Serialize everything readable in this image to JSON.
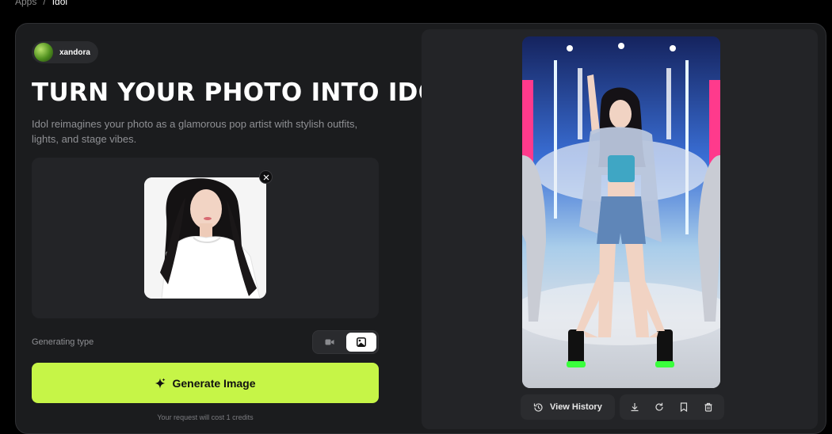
{
  "breadcrumb": {
    "root": "Apps",
    "separator": "/",
    "current": "Idol"
  },
  "author": {
    "name": "xandora"
  },
  "hero": {
    "title": "TURN YOUR PHOTO INTO IDOL",
    "description": "Idol reimagines your photo as a glamorous pop artist with stylish outfits, lights, and stage vibes."
  },
  "upload": {
    "icons": {
      "remove": "close-icon"
    }
  },
  "generating": {
    "label": "Generating type",
    "options": [
      {
        "icon": "video-icon",
        "active": false
      },
      {
        "icon": "image-icon",
        "active": true
      }
    ]
  },
  "generate": {
    "label": "Generate Image",
    "icon": "sparkle-icon",
    "accent": "#c6f547"
  },
  "cost_note": "Your request will cost 1 credits",
  "result": {
    "history_label": "View History",
    "actions": [
      "download-icon",
      "regenerate-icon",
      "bookmark-icon",
      "delete-icon"
    ]
  },
  "colors": {
    "background": "#000000",
    "card": "#1b1c1e",
    "panel": "#232427",
    "accent": "#c6f547"
  }
}
